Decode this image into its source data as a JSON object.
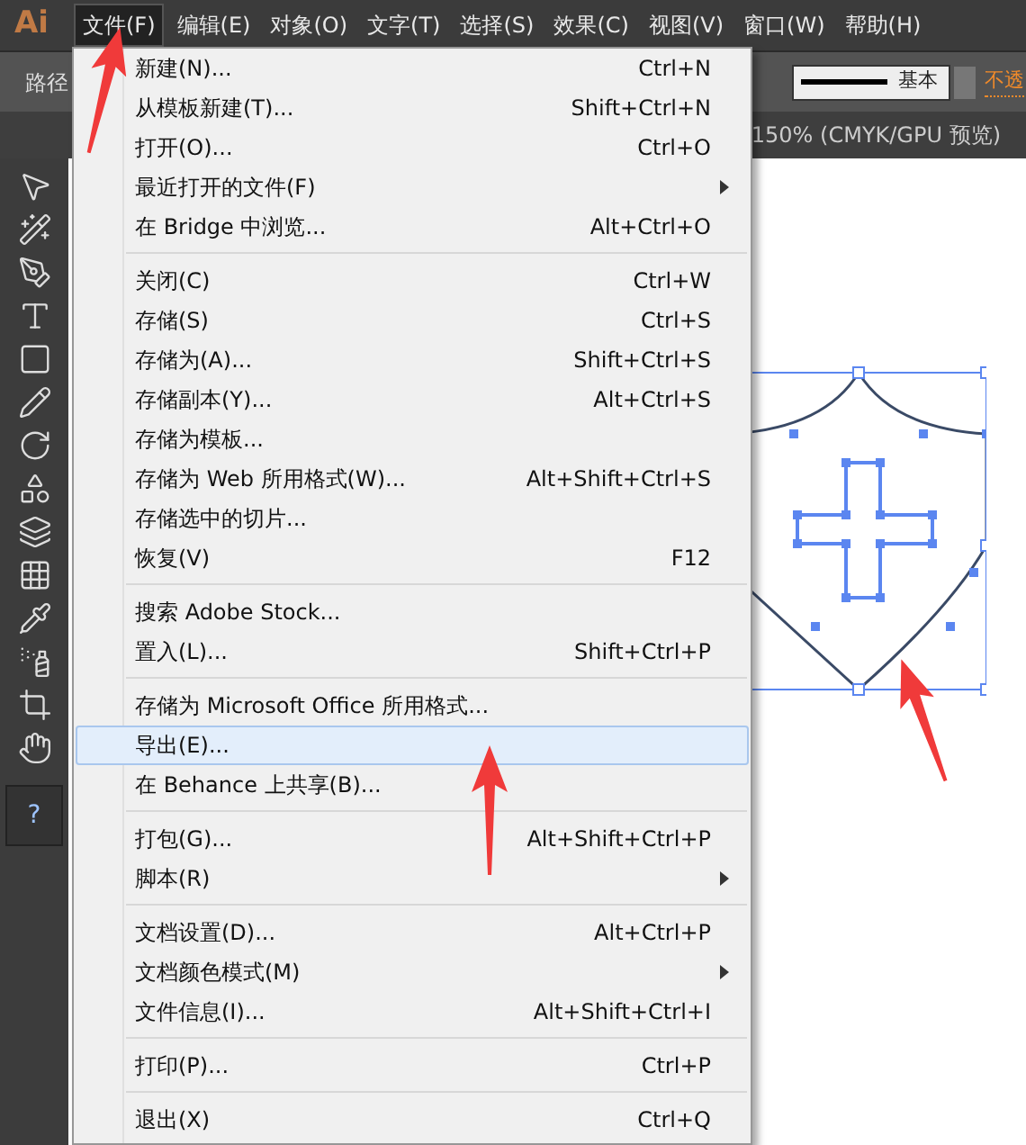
{
  "app_logo": "Ai",
  "menubar": [
    {
      "label": "文件(F)",
      "selected": true
    },
    {
      "label": "编辑(E)",
      "selected": false
    },
    {
      "label": "对象(O)",
      "selected": false
    },
    {
      "label": "文字(T)",
      "selected": false
    },
    {
      "label": "选择(S)",
      "selected": false
    },
    {
      "label": "效果(C)",
      "selected": false
    },
    {
      "label": "视图(V)",
      "selected": false
    },
    {
      "label": "窗口(W)",
      "selected": false
    },
    {
      "label": "帮助(H)",
      "selected": false
    }
  ],
  "control_bar": {
    "label": "路径",
    "stroke_style": "基本",
    "opacity_label": "不透"
  },
  "document_tab": {
    "title": "150% (CMYK/GPU 预览)"
  },
  "toolbox": {
    "help_label": "?"
  },
  "file_menu": {
    "groups": [
      [
        {
          "label": "新建(N)...",
          "shortcut": "Ctrl+N",
          "has_submenu": false,
          "selected": false
        },
        {
          "label": "从模板新建(T)...",
          "shortcut": "Shift+Ctrl+N",
          "has_submenu": false,
          "selected": false
        },
        {
          "label": "打开(O)...",
          "shortcut": "Ctrl+O",
          "has_submenu": false,
          "selected": false
        },
        {
          "label": "最近打开的文件(F)",
          "has_submenu": true,
          "selected": false
        },
        {
          "label": "在 Bridge 中浏览...",
          "shortcut": "Alt+Ctrl+O",
          "has_submenu": false,
          "selected": false
        }
      ],
      [
        {
          "label": "关闭(C)",
          "shortcut": "Ctrl+W",
          "has_submenu": false,
          "selected": false
        },
        {
          "label": "存储(S)",
          "shortcut": "Ctrl+S",
          "has_submenu": false,
          "selected": false
        },
        {
          "label": "存储为(A)...",
          "shortcut": "Shift+Ctrl+S",
          "has_submenu": false,
          "selected": false
        },
        {
          "label": "存储副本(Y)...",
          "shortcut": "Alt+Ctrl+S",
          "has_submenu": false,
          "selected": false
        },
        {
          "label": "存储为模板...",
          "has_submenu": false,
          "selected": false
        },
        {
          "label": "存储为 Web 所用格式(W)...",
          "shortcut": "Alt+Shift+Ctrl+S",
          "has_submenu": false,
          "selected": false
        },
        {
          "label": "存储选中的切片...",
          "has_submenu": false,
          "selected": false
        },
        {
          "label": "恢复(V)",
          "shortcut": "F12",
          "has_submenu": false,
          "selected": false
        }
      ],
      [
        {
          "label": "搜索 Adobe Stock...",
          "has_submenu": false,
          "selected": false
        },
        {
          "label": "置入(L)...",
          "shortcut": "Shift+Ctrl+P",
          "has_submenu": false,
          "selected": false
        }
      ],
      [
        {
          "label": "存储为 Microsoft Office 所用格式...",
          "has_submenu": false,
          "selected": false
        },
        {
          "label": "导出(E)...",
          "has_submenu": false,
          "selected": true
        },
        {
          "label": "在 Behance 上共享(B)...",
          "has_submenu": false,
          "selected": false
        }
      ],
      [
        {
          "label": "打包(G)...",
          "shortcut": "Alt+Shift+Ctrl+P",
          "has_submenu": false,
          "selected": false
        },
        {
          "label": "脚本(R)",
          "has_submenu": true,
          "selected": false
        }
      ],
      [
        {
          "label": "文档设置(D)...",
          "shortcut": "Alt+Ctrl+P",
          "has_submenu": false,
          "selected": false
        },
        {
          "label": "文档颜色模式(M)",
          "has_submenu": true,
          "selected": false
        },
        {
          "label": "文件信息(I)...",
          "shortcut": "Alt+Shift+Ctrl+I",
          "has_submenu": false,
          "selected": false
        }
      ],
      [
        {
          "label": "打印(P)...",
          "shortcut": "Ctrl+P",
          "has_submenu": false,
          "selected": false
        }
      ],
      [
        {
          "label": "退出(X)",
          "shortcut": "Ctrl+Q",
          "has_submenu": false,
          "selected": false
        }
      ]
    ]
  }
}
